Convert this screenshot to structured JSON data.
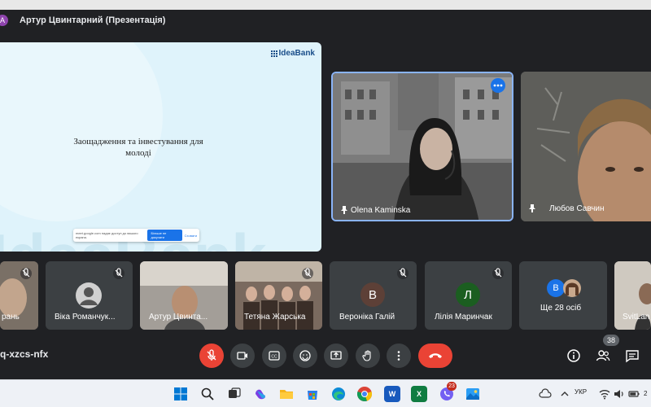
{
  "window": {
    "presenter_avatar_letter": "A",
    "title": "Артур Цвинтарний (Презентація)"
  },
  "slide": {
    "logo_text": "IdeaBank",
    "heading": "Заощадження та інвестування для молоді",
    "watermark_text": "IdeaBank",
    "share_popup": {
      "message": "meet.google.com надає доступ до вашого екрана.",
      "share_button": "Більше не докучати",
      "hide_button": "Сховати"
    }
  },
  "speakers": [
    {
      "name": "Olena Kaminska",
      "menu_icon": "more-horizontal-icon"
    },
    {
      "name": "Любов Савчин"
    }
  ],
  "participants": [
    {
      "name": "рань",
      "type": "video",
      "muted": true
    },
    {
      "name": "Віка Романчук...",
      "type": "avatar-photo",
      "muted": true
    },
    {
      "name": "Артур Цвинта...",
      "type": "video",
      "muted": false
    },
    {
      "name": "Тетяна Жарська",
      "type": "video",
      "muted": true
    },
    {
      "name": "Вероніка Галій",
      "type": "letter",
      "letter": "В",
      "color": "#5d4037",
      "muted": true
    },
    {
      "name": "Лілія Маринчак",
      "type": "letter",
      "letter": "Л",
      "color": "#1b5e20",
      "muted": true
    },
    {
      "name": "Ще 28 осіб",
      "type": "overflow",
      "letter": "В",
      "color": "#1a73e8"
    },
    {
      "name": "SvitLan",
      "type": "video",
      "muted": false
    }
  ],
  "controls": {
    "meeting_code": "q-xzcs-nfx",
    "people_count": "38",
    "buttons": [
      "mic-off-icon",
      "camera-icon",
      "captions-icon",
      "emoji-icon",
      "present-screen-icon",
      "raise-hand-icon",
      "more-vertical-icon",
      "end-call-icon"
    ],
    "right_buttons": [
      "info-icon",
      "people-icon",
      "chat-icon"
    ]
  },
  "taskbar": {
    "notification_count": "23",
    "language": "УКР",
    "time_fragment": "2",
    "apps": [
      "windows-start-icon",
      "search-icon",
      "task-view-icon",
      "copilot-icon",
      "file-explorer-icon",
      "store-icon",
      "edge-icon",
      "chrome-icon",
      "word-icon",
      "excel-icon",
      "viber-icon",
      "photos-icon"
    ]
  }
}
